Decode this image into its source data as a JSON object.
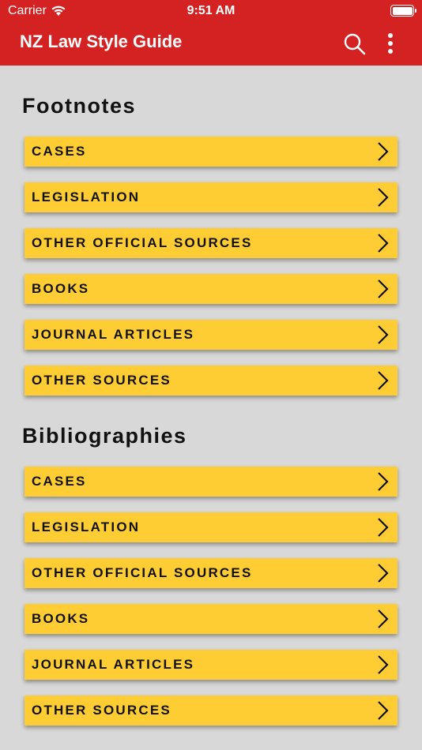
{
  "status_bar": {
    "carrier": "Carrier",
    "time": "9:51 AM"
  },
  "app_bar": {
    "title": "NZ Law Style Guide",
    "search_icon": "search-icon",
    "menu_icon": "more-vertical-icon",
    "color": "#d42222"
  },
  "accent_color": "#fecc33",
  "sections": [
    {
      "title": "Footnotes",
      "items": [
        {
          "label": "CASES"
        },
        {
          "label": "LEGISLATION"
        },
        {
          "label": "OTHER OFFICIAL SOURCES"
        },
        {
          "label": "BOOKS"
        },
        {
          "label": "JOURNAL ARTICLES"
        },
        {
          "label": "OTHER SOURCES"
        }
      ]
    },
    {
      "title": "Bibliographies",
      "items": [
        {
          "label": "CASES"
        },
        {
          "label": "LEGISLATION"
        },
        {
          "label": "OTHER OFFICIAL SOURCES"
        },
        {
          "label": "BOOKS"
        },
        {
          "label": "JOURNAL ARTICLES"
        },
        {
          "label": "OTHER SOURCES"
        }
      ]
    }
  ]
}
